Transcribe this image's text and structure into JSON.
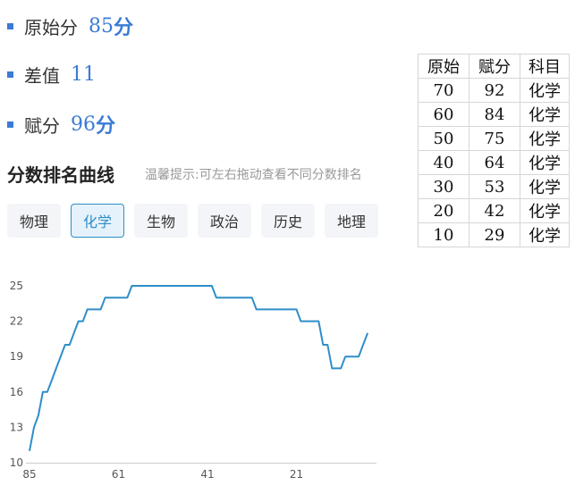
{
  "stats": {
    "original": {
      "label": "原始分",
      "value": "85",
      "unit": "分"
    },
    "diff": {
      "label": "差值",
      "value": "11"
    },
    "score": {
      "label": "赋分",
      "value": "96",
      "unit": "分"
    }
  },
  "section": {
    "title": "分数排名曲线",
    "hint": "温馨提示:可左右拖动查看不同分数排名"
  },
  "tabs": [
    {
      "label": "物理",
      "active": false
    },
    {
      "label": "化学",
      "active": true
    },
    {
      "label": "生物",
      "active": false
    },
    {
      "label": "政治",
      "active": false
    },
    {
      "label": "历史",
      "active": false
    },
    {
      "label": "地理",
      "active": false
    }
  ],
  "table": {
    "headers": [
      "原始",
      "赋分",
      "科目"
    ],
    "rows": [
      [
        "70",
        "92",
        "化学"
      ],
      [
        "60",
        "84",
        "化学"
      ],
      [
        "50",
        "75",
        "化学"
      ],
      [
        "40",
        "64",
        "化学"
      ],
      [
        "30",
        "53",
        "化学"
      ],
      [
        "20",
        "42",
        "化学"
      ],
      [
        "10",
        "29",
        "化学"
      ]
    ]
  },
  "colors": {
    "accent": "#3a7bd5",
    "line": "#2e8ec9",
    "tab_active_bg": "#e6f2fb"
  },
  "chart_data": {
    "type": "line",
    "x": [
      85,
      84,
      83,
      82,
      81,
      80,
      79,
      78,
      77,
      76,
      75,
      74,
      73,
      72,
      71,
      70,
      69,
      68,
      67,
      66,
      65,
      64,
      63,
      62,
      61,
      60,
      59,
      58,
      57,
      56,
      55,
      54,
      53,
      52,
      51,
      50,
      49,
      48,
      47,
      46,
      45,
      44,
      43,
      42,
      41,
      40,
      39,
      38,
      37,
      36,
      35,
      34,
      33,
      32,
      31,
      30,
      29,
      28,
      27,
      26,
      25,
      24,
      23,
      22,
      21,
      20,
      19,
      18,
      17,
      16,
      15,
      14,
      13,
      12,
      11,
      10,
      9,
      8,
      7
    ],
    "values": [
      11,
      13,
      14,
      16,
      16,
      17,
      18,
      19,
      20,
      20,
      21,
      22,
      22,
      23,
      23,
      23,
      23,
      24,
      24,
      24,
      24,
      24,
      24,
      25,
      25,
      25,
      25,
      25,
      25,
      25,
      25,
      25,
      25,
      25,
      25,
      25,
      25,
      25,
      25,
      25,
      25,
      25,
      24,
      24,
      24,
      24,
      24,
      24,
      24,
      24,
      24,
      23,
      23,
      23,
      23,
      23,
      23,
      23,
      23,
      23,
      23,
      22,
      22,
      22,
      22,
      22,
      20,
      20,
      18,
      18,
      18,
      19,
      19,
      19,
      19,
      20,
      21
    ],
    "xticks": [
      "85",
      "61",
      "41",
      "21"
    ],
    "xtick_values": [
      85,
      65,
      45,
      25
    ],
    "yticks": [
      "10",
      "13",
      "16",
      "19",
      "22",
      "25"
    ],
    "ylim": [
      10,
      25
    ],
    "xlim": [
      85,
      7
    ],
    "grid": false,
    "legend": "none"
  }
}
